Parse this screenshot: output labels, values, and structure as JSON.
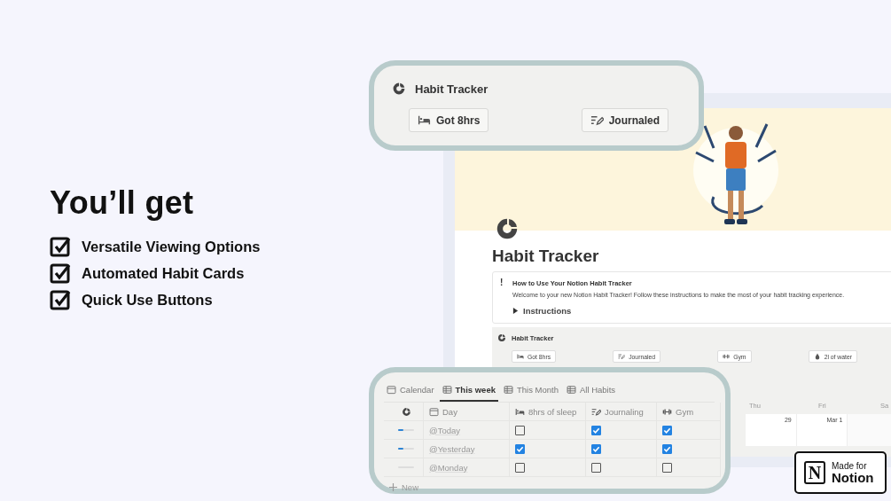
{
  "promo": {
    "heading": "You’ll get",
    "features": [
      {
        "label": "Versatile Viewing Options",
        "checked": true
      },
      {
        "label": "Automated Habit Cards",
        "checked": true
      },
      {
        "label": "Quick Use Buttons",
        "checked": true
      }
    ]
  },
  "page": {
    "title": "Habit Tracker",
    "callout": {
      "icon": "!",
      "title": "How to Use Your Notion Habit Tracker",
      "text": "Welcome to your new Notion Habit Tracker! Follow these instructions to make the most of your habit tracking experience.",
      "toggle": {
        "label": "Instructions",
        "expanded": false
      }
    },
    "tracker": {
      "title": "Habit Tracker",
      "buttons": [
        {
          "label": "Got 8hrs",
          "kind": "bed"
        },
        {
          "label": "Journaled",
          "kind": "journal"
        },
        {
          "label": "Gym",
          "kind": "dumbbell"
        },
        {
          "label": "2l of water",
          "kind": "drop"
        }
      ]
    },
    "calendar": {
      "weekdays": [
        "Thu",
        "Fri",
        "Sa"
      ],
      "dates": [
        "29",
        "Mar 1"
      ]
    }
  },
  "buttons_card": {
    "title": "Habit Tracker",
    "buttons": [
      {
        "label": "Got 8hrs",
        "kind": "bed"
      },
      {
        "label": "Journaled",
        "kind": "journal"
      }
    ]
  },
  "table_card": {
    "tabs": [
      {
        "label": "Calendar",
        "kind": "calendar",
        "selected": false
      },
      {
        "label": "This week",
        "kind": "table",
        "selected": true
      },
      {
        "label": "This Month",
        "kind": "table",
        "selected": false
      },
      {
        "label": "All Habits",
        "kind": "table",
        "selected": false
      }
    ],
    "columns": [
      {
        "label": "Day",
        "kind": "calendar"
      },
      {
        "label": "8hrs of sleep",
        "kind": "bed"
      },
      {
        "label": "Journaling",
        "kind": "journal"
      },
      {
        "label": "Gym",
        "kind": "dumbbell"
      }
    ],
    "rows": [
      {
        "level": 0.33,
        "day": "@Today",
        "checks": [
          false,
          true,
          true
        ]
      },
      {
        "level": 0.33,
        "day": "@Yesterday",
        "checks": [
          true,
          true,
          true
        ]
      },
      {
        "level": 0,
        "day": "@Monday",
        "checks": [
          false,
          false,
          false
        ]
      }
    ],
    "new_label": "New"
  },
  "badge": {
    "logo": "N",
    "line_1": "Made for",
    "line_2": "Notion"
  }
}
